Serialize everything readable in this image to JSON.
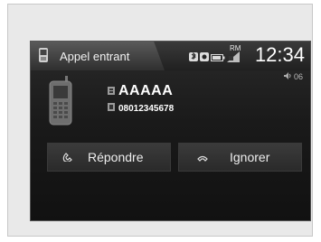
{
  "header": {
    "title": "Appel entrant",
    "rm_label": "RM",
    "clock": "12:34",
    "volume": "06"
  },
  "caller": {
    "name": "AAAAA",
    "number": "08012345678"
  },
  "actions": {
    "answer_label": "Répondre",
    "ignore_label": "Ignorer"
  },
  "icons": {
    "tab_icon": "phone-icon",
    "bluetooth": "bluetooth-icon",
    "battery": "battery-icon",
    "signal": "signal-icon",
    "caller_phone": "mobile-phone-icon",
    "name_icon": "contact-icon",
    "number_icon": "number-icon",
    "answer_icon": "phone-answer-icon",
    "ignore_icon": "phone-ignore-icon",
    "volume_icon": "speaker-icon"
  }
}
